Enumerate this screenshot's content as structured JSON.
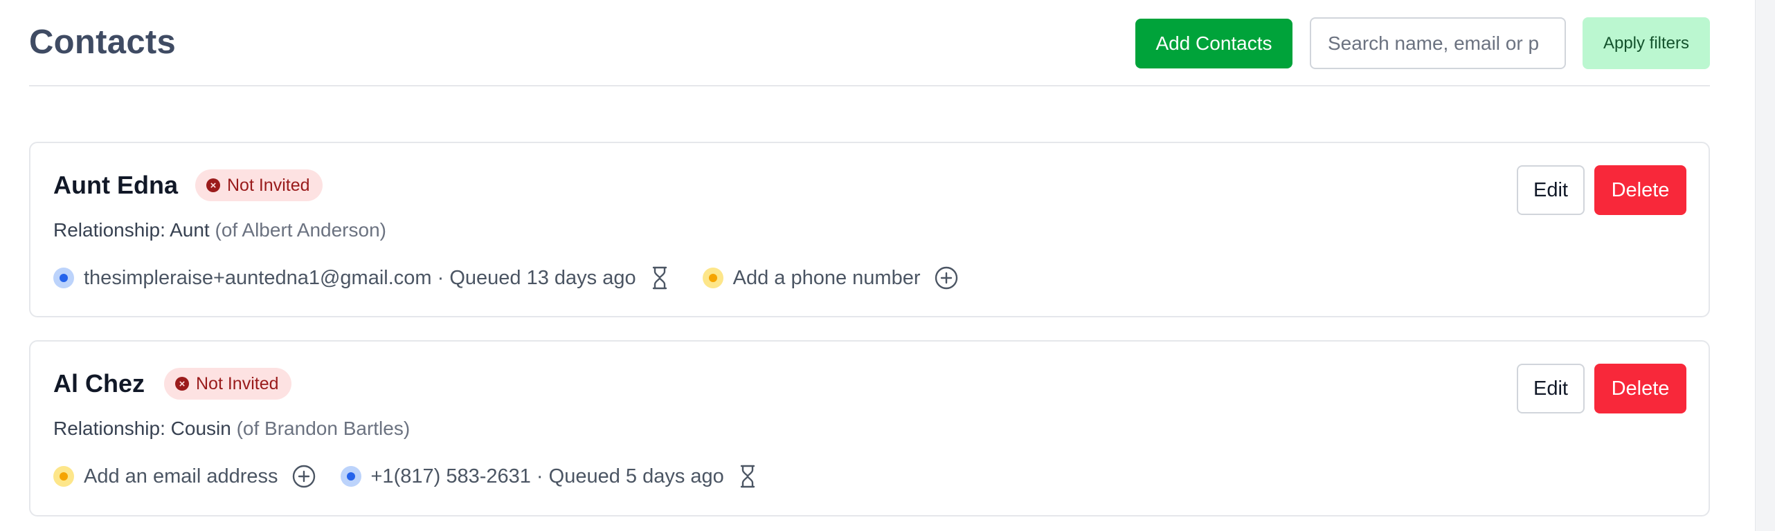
{
  "header": {
    "title": "Contacts",
    "add_label": "Add Contacts",
    "search_placeholder": "Search name, email or p",
    "filters_label": "Apply filters"
  },
  "colors": {
    "primary_green": "#00a33a",
    "filter_green": "#bbf7d0",
    "danger_red": "#f8283a",
    "badge_bg": "#fde2e2",
    "badge_text": "#991b1b",
    "title_color": "#3f4b63"
  },
  "contacts": [
    {
      "name": "Aunt Edna",
      "status": "Not Invited",
      "relationship_prefix": "Relationship: Aunt",
      "relationship_of": "(of Albert Anderson)",
      "methods": [
        {
          "type": "email",
          "dot": "blue",
          "text": "thesimpleraise+auntedna1@gmail.com · Queued 13 days ago",
          "icon": "hourglass-icon"
        },
        {
          "type": "phone",
          "dot": "yellow",
          "text": "Add a phone number",
          "icon": "plus-circle-icon"
        }
      ],
      "edit_label": "Edit",
      "delete_label": "Delete"
    },
    {
      "name": "Al Chez",
      "status": "Not Invited",
      "relationship_prefix": "Relationship: Cousin",
      "relationship_of": "(of Brandon Bartles)",
      "methods": [
        {
          "type": "email",
          "dot": "yellow",
          "text": "Add an email address",
          "icon": "plus-circle-icon"
        },
        {
          "type": "phone",
          "dot": "blue",
          "text": "+1(817) 583-2631 · Queued 5 days ago",
          "icon": "hourglass-icon"
        }
      ],
      "edit_label": "Edit",
      "delete_label": "Delete"
    }
  ]
}
